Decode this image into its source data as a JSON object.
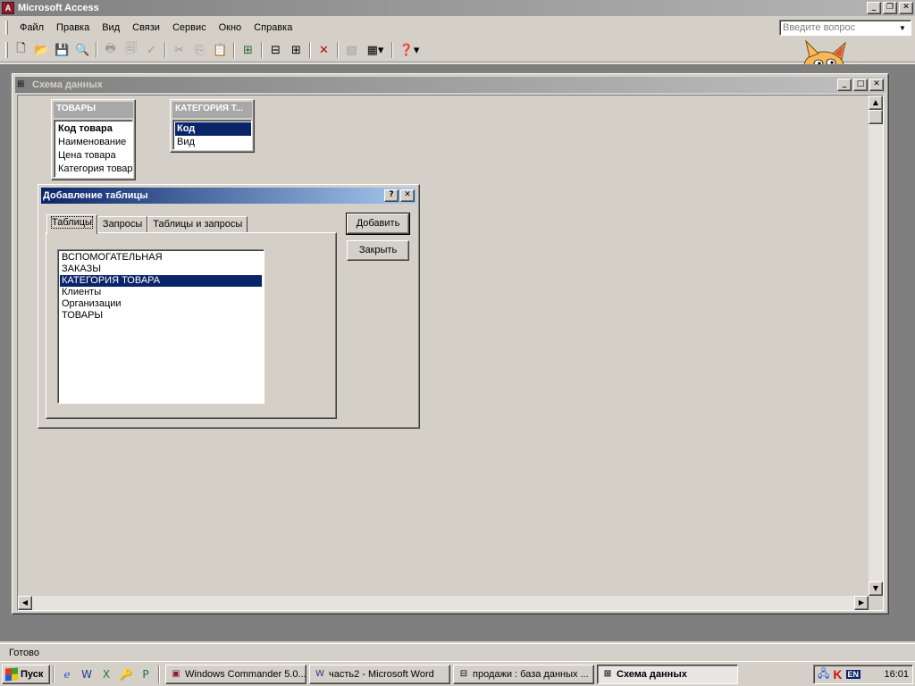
{
  "app": {
    "title": "Microsoft Access",
    "menu": [
      "Файл",
      "Правка",
      "Вид",
      "Связи",
      "Сервис",
      "Окно",
      "Справка"
    ],
    "ask_placeholder": "Введите вопрос"
  },
  "toolbar": {
    "icons": [
      "new-icon",
      "open-icon",
      "save-icon",
      "search-icon",
      "print-icon",
      "print-preview-icon",
      "spelling-icon",
      "cut-icon",
      "copy-icon",
      "paste-icon",
      "show-table-icon",
      "show-direct-icon",
      "show-all-icon",
      "delete-icon",
      "new-object-icon",
      "help-icon"
    ]
  },
  "schema_window": {
    "title": "Схема данных",
    "tables": [
      {
        "name": "ТОВАРЫ",
        "fields": [
          "Код товара",
          "Наименование",
          "Цена товара",
          "Категория товара"
        ]
      },
      {
        "name": "КАТЕГОРИЯ Т...",
        "fields": [
          "Код",
          "Вид"
        ]
      }
    ]
  },
  "dialog": {
    "title": "Добавление таблицы",
    "help_btn": "?",
    "close_btn": "✕",
    "tabs": [
      "Таблицы",
      "Запросы",
      "Таблицы и запросы"
    ],
    "list": [
      "ВСПОМОГАТЕЛЬНАЯ",
      "ЗАКАЗЫ",
      "КАТЕГОРИЯ ТОВАРА",
      "Клиенты",
      "Организации",
      "ТОВАРЫ"
    ],
    "selected": "КАТЕГОРИЯ ТОВАРА",
    "add_btn": "Добавить",
    "close_label": "Закрыть"
  },
  "status": {
    "text": "Готово"
  },
  "taskbar": {
    "start": "Пуск",
    "tasks": [
      "Windows Commander 5.0...",
      "часть2 - Microsoft Word",
      "продажи : база данных ...",
      "Схема данных"
    ],
    "lang": "EN",
    "clock": "16:01"
  },
  "colors": {
    "selection": "#0a246a",
    "face": "#d4d0c8",
    "mdi_bg": "#7f7f7f"
  }
}
